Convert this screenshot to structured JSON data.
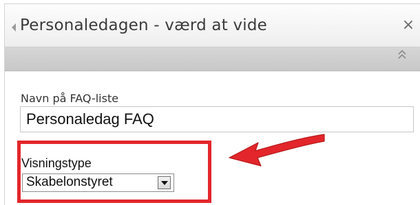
{
  "panel": {
    "title": "Personaledagen - værd at vide",
    "close_glyph": "×"
  },
  "form": {
    "faq_label": "Navn på FAQ-liste",
    "faq_value": "Personaledag FAQ",
    "view_label": "Visningstype",
    "view_selected": "Skabelonstyret"
  },
  "icons": {
    "collapse": "triangle-left-icon",
    "close": "close-icon",
    "expand": "double-chevron-up-icon",
    "dropdown": "chevron-down-icon",
    "annotation": "red-arrow-icon"
  },
  "colors": {
    "highlight": "#e3262b",
    "header_bar": "#cccccc"
  }
}
